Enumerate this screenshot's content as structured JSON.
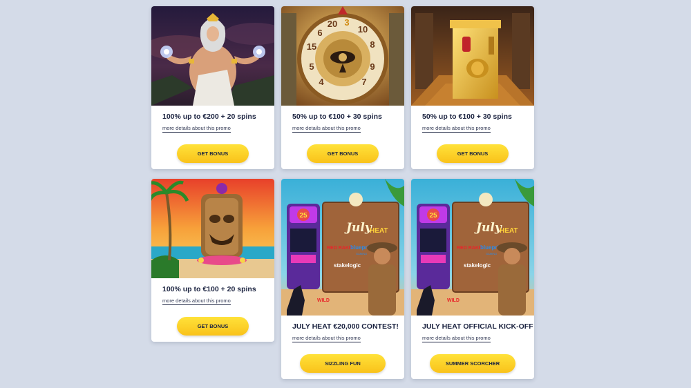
{
  "cards": [
    {
      "title": "100% up to €200 + 20 spins",
      "details": "more details about this promo",
      "button": "GET BONUS",
      "art": "zeus-slot-art"
    },
    {
      "title": "50% up to €100 + 30 spins",
      "details": "more details about this promo",
      "button": "GET BONUS",
      "art": "eye-of-horus-wheel-art"
    },
    {
      "title": "50% up to €100 + 30 spins",
      "details": "more details about this promo",
      "button": "GET BONUS",
      "art": "egyptian-scarab-shrine-art"
    },
    {
      "title": "100% up to €100 + 20 spins",
      "details": "more details about this promo",
      "button": "GET BONUS",
      "art": "tiki-beach-art"
    },
    {
      "title": "JULY HEAT €20,000 CONTEST!",
      "details": "more details about this promo",
      "button": "SIZZLING FUN",
      "art": "july-heat-slot-art"
    },
    {
      "title": "JULY HEAT OFFICIAL KICK-OFF",
      "details": "more details about this promo",
      "button": "SUMMER SCORCHER",
      "art": "july-heat-slot-art"
    }
  ],
  "wheel_numbers": [
    "15",
    "6",
    "20",
    "3",
    "10",
    "8",
    "9",
    "7",
    "4",
    "5"
  ],
  "july_heat": {
    "logo_line1": "July",
    "logo_line2": "HEAT",
    "brand1": "RED RAKE",
    "brand2": "blueprint",
    "brand2_sub": "GAMING",
    "brand3": "stakelogic",
    "machine_number": "25",
    "tag": "WILD"
  },
  "colors": {
    "page_bg": "#d4dbe8",
    "button": "#fdd42a",
    "title": "#1b2340"
  }
}
